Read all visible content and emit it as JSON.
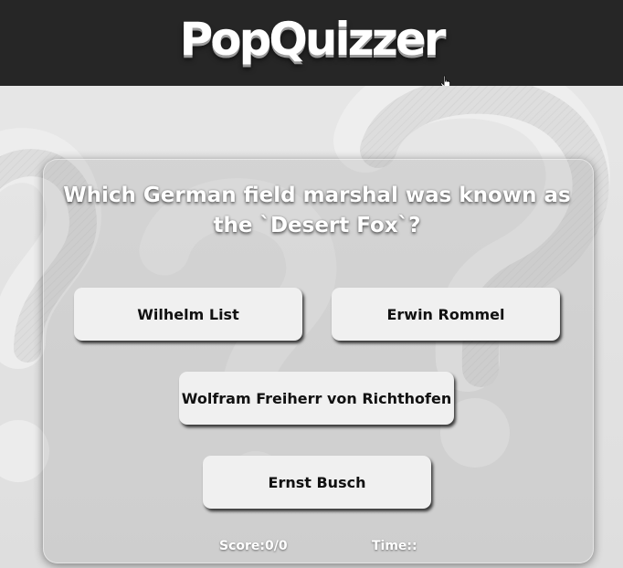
{
  "header": {
    "logo_text": "PopQuizzer"
  },
  "quiz": {
    "question": "Which German field marshal was known as the `Desert Fox`?",
    "answers": [
      "Wilhelm List",
      "Erwin Rommel",
      "Wolfram Freiherr von Richthofen",
      "Ernst Busch"
    ]
  },
  "status": {
    "score_label": "Score:",
    "score_value": "0/0",
    "time_label": "Time:",
    "time_value": ":"
  },
  "colors": {
    "header_bg": "#262626",
    "page_bg": "#e9e9e9",
    "button_bg": "#f0f0f0",
    "text_on_card": "#ffffff"
  },
  "icons": {
    "background_decoration": "question-mark-icon",
    "cursor": "hand-pointer-icon"
  }
}
